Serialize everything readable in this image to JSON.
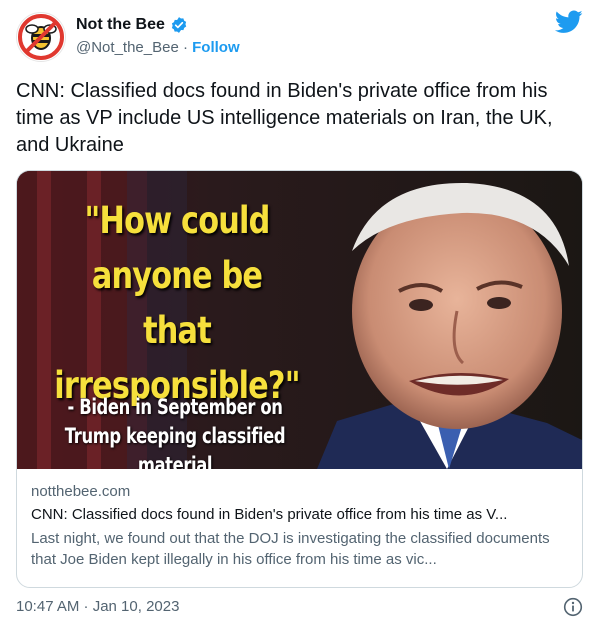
{
  "author": {
    "display_name": "Not the Bee",
    "handle": "@Not_the_Bee",
    "separator": "·",
    "follow_label": "Follow",
    "verified": true
  },
  "tweet": {
    "text": "CNN: Classified docs found in Biden's private office from his time as VP include US intelligence materials on Iran, the UK, and Ukraine"
  },
  "card": {
    "image_quote": "\"How could anyone be that irresponsible?\"",
    "image_attribution": "- Biden in September on Trump keeping classified material",
    "domain": "notthebee.com",
    "title": "CNN: Classified docs found in Biden's private office from his time as V...",
    "description": "Last night, we found out that the DOJ is investigating the classified documents that Joe Biden kept illegally in his office from his time as vic..."
  },
  "footer": {
    "timestamp": "10:47 AM · Jan 10, 2023"
  },
  "icons": {
    "twitter": "twitter-bird-icon",
    "verified": "verified-badge-icon",
    "info": "info-icon",
    "avatar": "bee-logo"
  },
  "colors": {
    "accent": "#1d9bf0",
    "text": "#0f1419",
    "muted": "#536471",
    "border": "#cfd9de",
    "quote_yellow": "#f6e03c"
  }
}
